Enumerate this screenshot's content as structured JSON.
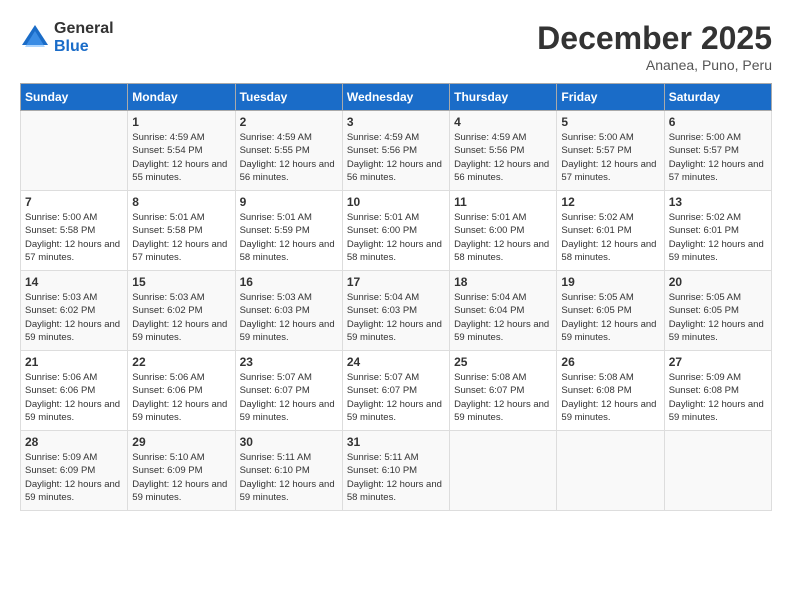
{
  "header": {
    "logo": {
      "general": "General",
      "blue": "Blue"
    },
    "title": "December 2025",
    "subtitle": "Ananea, Puno, Peru"
  },
  "weekdays": [
    "Sunday",
    "Monday",
    "Tuesday",
    "Wednesday",
    "Thursday",
    "Friday",
    "Saturday"
  ],
  "weeks": [
    [
      {
        "day": "",
        "sunrise": "",
        "sunset": "",
        "daylight": ""
      },
      {
        "day": "1",
        "sunrise": "Sunrise: 4:59 AM",
        "sunset": "Sunset: 5:54 PM",
        "daylight": "Daylight: 12 hours and 55 minutes."
      },
      {
        "day": "2",
        "sunrise": "Sunrise: 4:59 AM",
        "sunset": "Sunset: 5:55 PM",
        "daylight": "Daylight: 12 hours and 56 minutes."
      },
      {
        "day": "3",
        "sunrise": "Sunrise: 4:59 AM",
        "sunset": "Sunset: 5:56 PM",
        "daylight": "Daylight: 12 hours and 56 minutes."
      },
      {
        "day": "4",
        "sunrise": "Sunrise: 4:59 AM",
        "sunset": "Sunset: 5:56 PM",
        "daylight": "Daylight: 12 hours and 56 minutes."
      },
      {
        "day": "5",
        "sunrise": "Sunrise: 5:00 AM",
        "sunset": "Sunset: 5:57 PM",
        "daylight": "Daylight: 12 hours and 57 minutes."
      },
      {
        "day": "6",
        "sunrise": "Sunrise: 5:00 AM",
        "sunset": "Sunset: 5:57 PM",
        "daylight": "Daylight: 12 hours and 57 minutes."
      }
    ],
    [
      {
        "day": "7",
        "sunrise": "Sunrise: 5:00 AM",
        "sunset": "Sunset: 5:58 PM",
        "daylight": "Daylight: 12 hours and 57 minutes."
      },
      {
        "day": "8",
        "sunrise": "Sunrise: 5:01 AM",
        "sunset": "Sunset: 5:58 PM",
        "daylight": "Daylight: 12 hours and 57 minutes."
      },
      {
        "day": "9",
        "sunrise": "Sunrise: 5:01 AM",
        "sunset": "Sunset: 5:59 PM",
        "daylight": "Daylight: 12 hours and 58 minutes."
      },
      {
        "day": "10",
        "sunrise": "Sunrise: 5:01 AM",
        "sunset": "Sunset: 6:00 PM",
        "daylight": "Daylight: 12 hours and 58 minutes."
      },
      {
        "day": "11",
        "sunrise": "Sunrise: 5:01 AM",
        "sunset": "Sunset: 6:00 PM",
        "daylight": "Daylight: 12 hours and 58 minutes."
      },
      {
        "day": "12",
        "sunrise": "Sunrise: 5:02 AM",
        "sunset": "Sunset: 6:01 PM",
        "daylight": "Daylight: 12 hours and 58 minutes."
      },
      {
        "day": "13",
        "sunrise": "Sunrise: 5:02 AM",
        "sunset": "Sunset: 6:01 PM",
        "daylight": "Daylight: 12 hours and 59 minutes."
      }
    ],
    [
      {
        "day": "14",
        "sunrise": "Sunrise: 5:03 AM",
        "sunset": "Sunset: 6:02 PM",
        "daylight": "Daylight: 12 hours and 59 minutes."
      },
      {
        "day": "15",
        "sunrise": "Sunrise: 5:03 AM",
        "sunset": "Sunset: 6:02 PM",
        "daylight": "Daylight: 12 hours and 59 minutes."
      },
      {
        "day": "16",
        "sunrise": "Sunrise: 5:03 AM",
        "sunset": "Sunset: 6:03 PM",
        "daylight": "Daylight: 12 hours and 59 minutes."
      },
      {
        "day": "17",
        "sunrise": "Sunrise: 5:04 AM",
        "sunset": "Sunset: 6:03 PM",
        "daylight": "Daylight: 12 hours and 59 minutes."
      },
      {
        "day": "18",
        "sunrise": "Sunrise: 5:04 AM",
        "sunset": "Sunset: 6:04 PM",
        "daylight": "Daylight: 12 hours and 59 minutes."
      },
      {
        "day": "19",
        "sunrise": "Sunrise: 5:05 AM",
        "sunset": "Sunset: 6:05 PM",
        "daylight": "Daylight: 12 hours and 59 minutes."
      },
      {
        "day": "20",
        "sunrise": "Sunrise: 5:05 AM",
        "sunset": "Sunset: 6:05 PM",
        "daylight": "Daylight: 12 hours and 59 minutes."
      }
    ],
    [
      {
        "day": "21",
        "sunrise": "Sunrise: 5:06 AM",
        "sunset": "Sunset: 6:06 PM",
        "daylight": "Daylight: 12 hours and 59 minutes."
      },
      {
        "day": "22",
        "sunrise": "Sunrise: 5:06 AM",
        "sunset": "Sunset: 6:06 PM",
        "daylight": "Daylight: 12 hours and 59 minutes."
      },
      {
        "day": "23",
        "sunrise": "Sunrise: 5:07 AM",
        "sunset": "Sunset: 6:07 PM",
        "daylight": "Daylight: 12 hours and 59 minutes."
      },
      {
        "day": "24",
        "sunrise": "Sunrise: 5:07 AM",
        "sunset": "Sunset: 6:07 PM",
        "daylight": "Daylight: 12 hours and 59 minutes."
      },
      {
        "day": "25",
        "sunrise": "Sunrise: 5:08 AM",
        "sunset": "Sunset: 6:07 PM",
        "daylight": "Daylight: 12 hours and 59 minutes."
      },
      {
        "day": "26",
        "sunrise": "Sunrise: 5:08 AM",
        "sunset": "Sunset: 6:08 PM",
        "daylight": "Daylight: 12 hours and 59 minutes."
      },
      {
        "day": "27",
        "sunrise": "Sunrise: 5:09 AM",
        "sunset": "Sunset: 6:08 PM",
        "daylight": "Daylight: 12 hours and 59 minutes."
      }
    ],
    [
      {
        "day": "28",
        "sunrise": "Sunrise: 5:09 AM",
        "sunset": "Sunset: 6:09 PM",
        "daylight": "Daylight: 12 hours and 59 minutes."
      },
      {
        "day": "29",
        "sunrise": "Sunrise: 5:10 AM",
        "sunset": "Sunset: 6:09 PM",
        "daylight": "Daylight: 12 hours and 59 minutes."
      },
      {
        "day": "30",
        "sunrise": "Sunrise: 5:11 AM",
        "sunset": "Sunset: 6:10 PM",
        "daylight": "Daylight: 12 hours and 59 minutes."
      },
      {
        "day": "31",
        "sunrise": "Sunrise: 5:11 AM",
        "sunset": "Sunset: 6:10 PM",
        "daylight": "Daylight: 12 hours and 58 minutes."
      },
      {
        "day": "",
        "sunrise": "",
        "sunset": "",
        "daylight": ""
      },
      {
        "day": "",
        "sunrise": "",
        "sunset": "",
        "daylight": ""
      },
      {
        "day": "",
        "sunrise": "",
        "sunset": "",
        "daylight": ""
      }
    ]
  ]
}
